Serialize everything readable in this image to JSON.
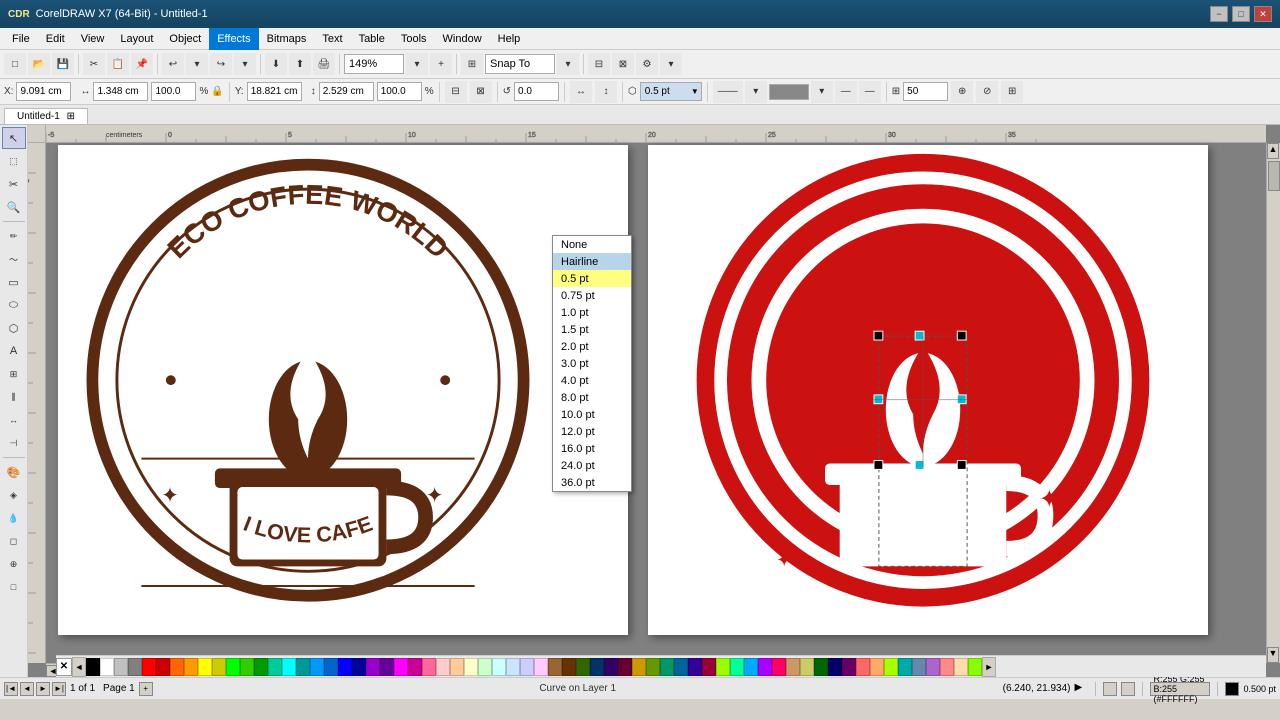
{
  "titlebar": {
    "title": "CorelDRAW X7 (64-Bit) - Untitled-1",
    "logo": "CDR",
    "min_btn": "−",
    "max_btn": "□",
    "close_btn": "✕"
  },
  "menubar": {
    "items": [
      "File",
      "Edit",
      "View",
      "Layout",
      "Object",
      "Effects",
      "Bitmaps",
      "Text",
      "Table",
      "Tools",
      "Window",
      "Help"
    ]
  },
  "toolbar1": {
    "new": "□",
    "open": "📂",
    "save": "💾",
    "zoom_level": "149%",
    "snap_to": "Snap To"
  },
  "propbar": {
    "x_label": "X:",
    "x_value": "9.091 cm",
    "y_label": "Y:",
    "y_value": "18.821 cm",
    "w_label": "",
    "w_value": "1.348 cm",
    "h_value": "2.529 cm",
    "lock_icon": "🔒",
    "pct1": "100.0",
    "pct2": "100.0",
    "angle": "0.0",
    "outline_value": "0.5 pt",
    "outline_options": [
      "None",
      "Hairline",
      "0.5 pt",
      "0.75 pt",
      "1.0 pt",
      "1.5 pt",
      "2.0 pt",
      "3.0 pt",
      "4.0 pt",
      "8.0 pt",
      "10.0 pt",
      "12.0 pt",
      "16.0 pt",
      "24.0 pt",
      "36.0 pt"
    ]
  },
  "tabs": {
    "items": [
      "Untitled-1"
    ]
  },
  "canvas": {
    "background": "#808080"
  },
  "dropdown": {
    "items": [
      "None",
      "Hairline",
      "0.5 pt",
      "0.75 pt",
      "1.0 pt",
      "1.5 pt",
      "2.0 pt",
      "3.0 pt",
      "4.0 pt",
      "8.0 pt",
      "10.0 pt",
      "12.0 pt",
      "16.0 pt",
      "24.0 pt",
      "36.0 pt"
    ],
    "highlighted_index": 1,
    "selected_index": 2
  },
  "statusbar": {
    "page_info": "1 of 1",
    "page_name": "Page 1",
    "curve_info": "Curve on Layer 1",
    "coords": "(6.240, 21.934)",
    "color_info": "R:255 G:255 B:255 (#FFFFFF)",
    "fill_info": "R:0 G:0 B:0 (#000000)",
    "outline_info": "0.500 pt"
  },
  "tools": {
    "items": [
      "↖",
      "▷",
      "⬚",
      "✏",
      "🖊",
      "⚪",
      "📝",
      "🔷",
      "📐",
      "🌀",
      "✂",
      "🔵",
      "A",
      "↔",
      "🖐",
      "🔍",
      "📊",
      "🎨",
      "🖌",
      "💧",
      "◻",
      "🔧"
    ]
  },
  "colors": {
    "swatches": [
      "#ffffff",
      "#000000",
      "#c0c0c0",
      "#808080",
      "#ff0000",
      "#800000",
      "#ff6600",
      "#ff9900",
      "#ffff00",
      "#808000",
      "#00ff00",
      "#008000",
      "#00ffff",
      "#008080",
      "#0000ff",
      "#000080",
      "#ff00ff",
      "#800080",
      "#ff6688",
      "#ffcccc",
      "#ffcc99",
      "#ffffcc",
      "#ccffcc",
      "#ccffff",
      "#cce5ff",
      "#ccccff",
      "#ffccff",
      "#996633",
      "#663300",
      "#336600",
      "#003366",
      "#330066",
      "#660033",
      "#996600",
      "#669900",
      "#009966",
      "#006699",
      "#330099",
      "#990033"
    ]
  }
}
